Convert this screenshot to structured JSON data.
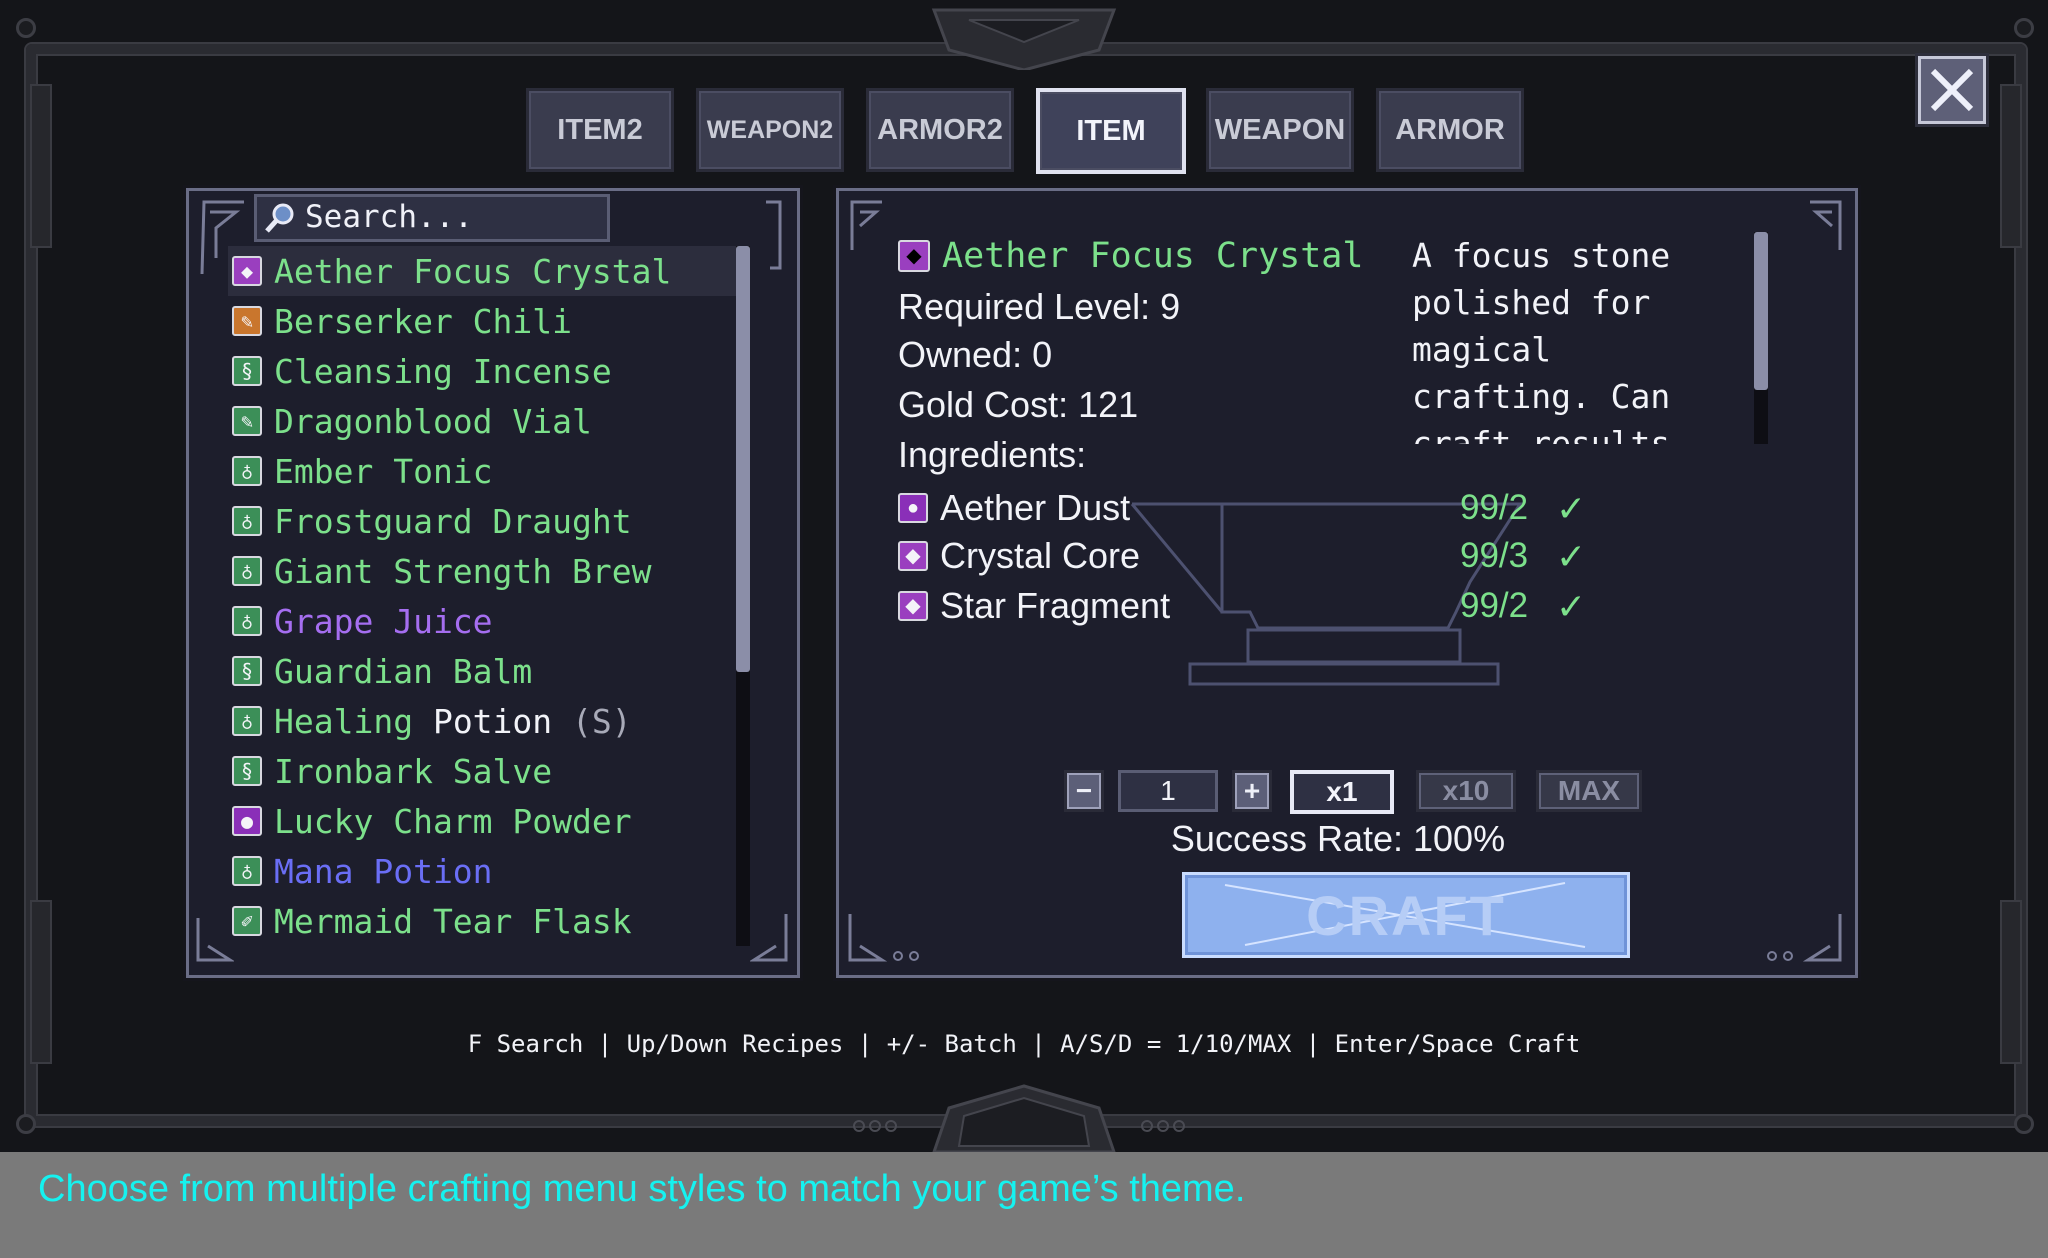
{
  "tabs": [
    {
      "label": "ITEM2",
      "active": false
    },
    {
      "label": "WEAPON2",
      "active": false
    },
    {
      "label": "ARMOR2",
      "active": false
    },
    {
      "label": "ITEM",
      "active": true
    },
    {
      "label": "WEAPON",
      "active": false
    },
    {
      "label": "ARMOR",
      "active": false
    }
  ],
  "search": {
    "placeholder": "Search..."
  },
  "recipes": [
    {
      "name": "Aether Focus Crystal",
      "color": "#7ce08b",
      "icon": "crystal-icon",
      "icon_bg": "#9a3fbf"
    },
    {
      "name": "Berserker Chili",
      "color": "#7ce08b",
      "icon": "chili-icon",
      "icon_bg": "#c9762d"
    },
    {
      "name": "Cleansing Incense",
      "color": "#7ce08b",
      "icon": "scroll-icon",
      "icon_bg": "#3c8f58"
    },
    {
      "name": "Dragonblood Vial",
      "color": "#7ce08b",
      "icon": "vial-icon",
      "icon_bg": "#3c8f58"
    },
    {
      "name": "Ember Tonic",
      "color": "#7ce08b",
      "icon": "potion-icon",
      "icon_bg": "#3c8f58"
    },
    {
      "name": "Frostguard Draught",
      "color": "#7ce08b",
      "icon": "potion-icon",
      "icon_bg": "#3c8f58"
    },
    {
      "name": "Giant Strength Brew",
      "color": "#7ce08b",
      "icon": "potion-icon",
      "icon_bg": "#3c8f58"
    },
    {
      "name": "Grape Juice",
      "color": "#a56ef0",
      "icon": "potion-icon",
      "icon_bg": "#3c8f58"
    },
    {
      "name": "Guardian Balm",
      "color": "#7ce08b",
      "icon": "scroll-icon",
      "icon_bg": "#3c8f58"
    },
    {
      "name": "Healing",
      "name_extra": " Potion",
      "suffix": " (S)",
      "color": "#7ce08b",
      "icon": "potion-icon",
      "icon_bg": "#3c8f58"
    },
    {
      "name": "Ironbark Salve",
      "color": "#7ce08b",
      "icon": "scroll-icon",
      "icon_bg": "#3c8f58"
    },
    {
      "name": "Lucky Charm Powder",
      "color": "#7ce08b",
      "icon": "orb-icon",
      "icon_bg": "#8a2fb8"
    },
    {
      "name": "Mana Potion",
      "color": "#6a6ef5",
      "icon": "potion-icon",
      "icon_bg": "#3c8f58"
    },
    {
      "name": "Mermaid Tear Flask",
      "color": "#7ce08b",
      "icon": "quill-icon",
      "icon_bg": "#3c8f58"
    }
  ],
  "detail": {
    "title": "Aether Focus Crystal",
    "required_level": "Required Level: 9",
    "owned": "Owned: 0",
    "gold_cost": "Gold Cost: 121",
    "ingredients_label": "Ingredients:",
    "description": "A focus stone polished for magical crafting. Can craft results from Uncommon up"
  },
  "ingredients": [
    {
      "name": "Aether Dust",
      "qty": "99/2",
      "check": "✓",
      "icon": "orb-icon"
    },
    {
      "name": "Crystal Core",
      "qty": "99/3",
      "check": "✓",
      "icon": "crystal-icon"
    },
    {
      "name": "Star Fragment",
      "qty": "99/2",
      "check": "✓",
      "icon": "crystal-icon"
    }
  ],
  "controls": {
    "minus": "−",
    "quantity": "1",
    "plus": "+",
    "x1": "x1",
    "x10": "x10",
    "max": "MAX",
    "success_rate": "Success Rate: 100%",
    "craft": "CRAFT"
  },
  "hint": "F Search | Up/Down Recipes | +/- Batch | A/S/D = 1/10/MAX | Enter/Space Craft",
  "caption": "Choose from multiple crafting menu styles to match your game’s theme."
}
